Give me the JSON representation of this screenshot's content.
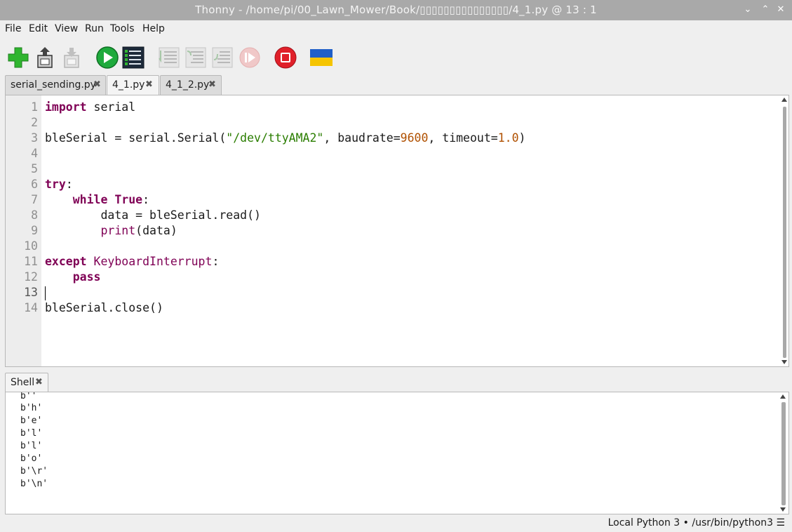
{
  "window": {
    "title": "Thonny  -  /home/pi/00_Lawn_Mower/Book/▯▯▯▯▯▯▯▯▯▯▯▯▯▯▯/4_1.py  @  13 : 1",
    "controls": [
      "⌄",
      "⌃",
      "✕"
    ]
  },
  "menu": [
    "File",
    "Edit",
    "View",
    "Run",
    "Tools",
    "Help"
  ],
  "toolbar": {
    "buttons": [
      {
        "name": "new-file",
        "icon": "plus-icon",
        "enabled": true
      },
      {
        "name": "open-file",
        "icon": "open-icon",
        "enabled": true
      },
      {
        "name": "save-file",
        "icon": "save-icon",
        "enabled": false
      },
      {
        "name": "run",
        "icon": "play-icon",
        "enabled": true
      },
      {
        "name": "debug",
        "icon": "debug-icon",
        "enabled": true
      },
      {
        "name": "step-over",
        "icon": "step-over-icon",
        "enabled": false
      },
      {
        "name": "step-into",
        "icon": "step-into-icon",
        "enabled": false
      },
      {
        "name": "step-out",
        "icon": "step-out-icon",
        "enabled": false
      },
      {
        "name": "resume",
        "icon": "resume-icon",
        "enabled": false
      },
      {
        "name": "stop",
        "icon": "stop-icon",
        "enabled": true
      },
      {
        "name": "ukraine",
        "icon": "ukraine-flag-icon",
        "enabled": true
      }
    ]
  },
  "tabs": [
    {
      "label": "serial_sending.py",
      "close": "✖"
    },
    {
      "label": "4_1.py",
      "close": "✖",
      "active": true
    },
    {
      "label": "4_1_2.py",
      "close": "✖"
    }
  ],
  "editor": {
    "line_numbers": [
      "1",
      "2",
      "3",
      "4",
      "5",
      "6",
      "7",
      "8",
      "9",
      "10",
      "11",
      "12",
      "13",
      "14"
    ],
    "current_line": "13",
    "code": {
      "l1_kw": "import",
      "l1_rest": " serial",
      "l3_a": "bleSerial = serial.Serial(",
      "l3_str": "\"/dev/ttyAMA2\"",
      "l3_b": ", baudrate=",
      "l3_num1": "9600",
      "l3_c": ", timeout=",
      "l3_num2": "1.0",
      "l3_d": ")",
      "l6_kw": "try",
      "l6_rest": ":",
      "l7_indent": "    ",
      "l7_kw": "while",
      "l7_sp": " ",
      "l7_kw2": "True",
      "l7_rest": ":",
      "l8": "        data = bleSerial.read()",
      "l9_indent": "        ",
      "l9_bi": "print",
      "l9_rest": "(data)",
      "l11_kw": "except",
      "l11_sp": " ",
      "l11_bi": "KeyboardInterrupt",
      "l11_rest": ":",
      "l12_indent": "    ",
      "l12_kw": "pass",
      "l14": "bleSerial.close()"
    }
  },
  "shell": {
    "tab_label": "Shell",
    "close": "✖",
    "lines": [
      "b''",
      "b'h'",
      "b'e'",
      "b'l'",
      "b'l'",
      "b'o'",
      "b'\\r'",
      "b'\\n'"
    ]
  },
  "status": {
    "text": "Local Python 3  •  /usr/bin/python3",
    "menu_icon": "☰"
  },
  "colors": {
    "keyword": "#7f0055",
    "string": "#2a7d00",
    "number": "#b05000",
    "run_green": "#1eaa3c",
    "stop_red": "#e0202a"
  }
}
